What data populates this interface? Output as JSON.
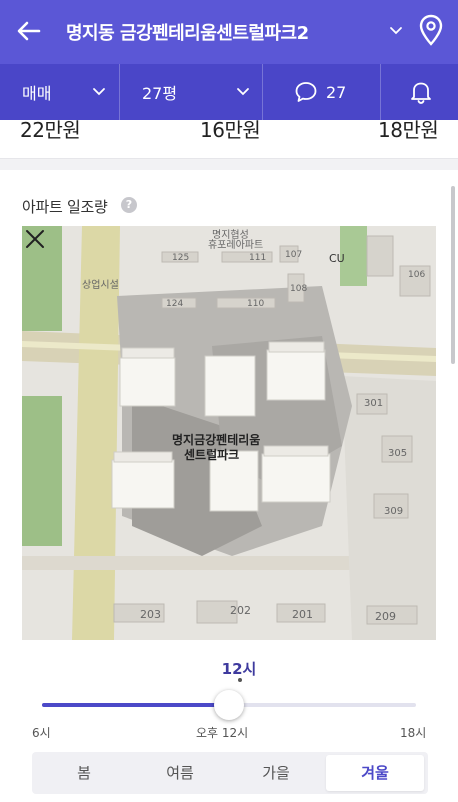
{
  "header": {
    "title": "명지동 금강펜테리움센트럴파크2"
  },
  "filters": {
    "deal_type": "매매",
    "area": "27평",
    "comments_count": "27"
  },
  "prices": [
    "22만원",
    "16만원",
    "18만원"
  ],
  "section": {
    "title": "아파트 일조량",
    "help": "?"
  },
  "map": {
    "complex_label_line1": "명지금강펜테리움",
    "complex_label_line2": "센트럴파크",
    "neighbor_label_line1": "명지협성",
    "neighbor_label_line2": "휴포레아파트",
    "shopping_label": "상업시설",
    "store_label": "CU",
    "building_numbers": [
      "125",
      "111",
      "107",
      "124",
      "110",
      "108",
      "301",
      "305",
      "309",
      "203",
      "202",
      "201",
      "209",
      "106"
    ]
  },
  "sun": {
    "current_time": "12시",
    "slider_value": 0.5,
    "start_label": "6시",
    "middle_label": "오후 12시",
    "end_label": "18시"
  },
  "seasons": {
    "items": [
      "봄",
      "여름",
      "가을",
      "겨울"
    ],
    "active_index": 3
  },
  "colors": {
    "header_bg": "#5b57d6",
    "filter_bg": "#4a46c8",
    "accent": "#4c49c8"
  }
}
